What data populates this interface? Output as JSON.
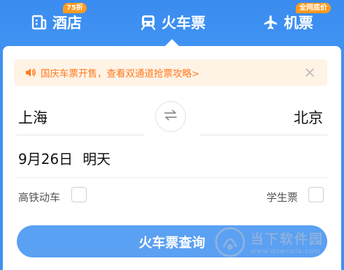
{
  "nav": {
    "tabs": [
      {
        "label": "酒店",
        "icon": "hotel-icon",
        "badge": "75折"
      },
      {
        "label": "火车票",
        "icon": "train-icon",
        "active": true
      },
      {
        "label": "机票",
        "icon": "airplane-icon",
        "badge": "全网底价"
      }
    ]
  },
  "notice": {
    "text": "国庆车票开售，查看双通道抢票攻略>",
    "icon": "speaker-icon",
    "close_icon": "close-icon",
    "color": "#ff7a1a",
    "background": "#fff3e6"
  },
  "route": {
    "from": "上海",
    "to": "北京",
    "swap_icon": "swap-icon"
  },
  "date": {
    "value": "9月26日",
    "day": "明天"
  },
  "options": {
    "high_speed_label": "高铁动车",
    "student_label": "学生票"
  },
  "search": {
    "button_label": "火车票查询"
  },
  "watermark": {
    "title": "当下软件园",
    "url": "www.downxia.com"
  },
  "colors": {
    "brand_blue": "#3d8ff0",
    "button_blue": "#5aa0f3",
    "badge_orange": "#ff9a1f"
  }
}
